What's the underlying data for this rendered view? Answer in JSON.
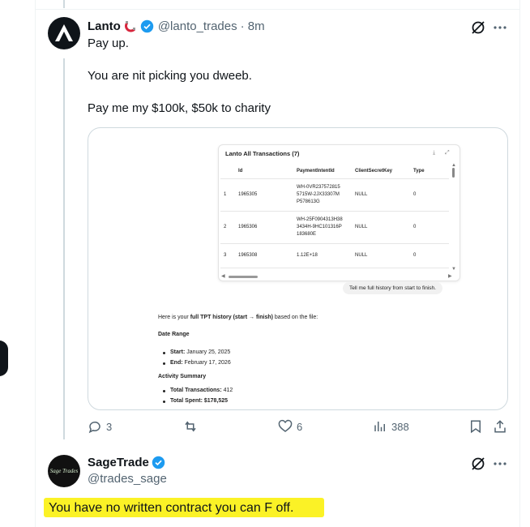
{
  "tweet": {
    "author_name": "Lanto",
    "handle": "@lanto_trades",
    "time": "· 8m",
    "lines": [
      "Pay up.",
      "You are nit picking you dweeb.",
      "Pay me my $100k, $50k to charity"
    ],
    "media": {
      "card_title": "Lanto All Transactions (7)",
      "columns": [
        "",
        "Id",
        "PaymentIntentId",
        "ClientSecretKey",
        "Type"
      ],
      "rows": [
        {
          "n": "1",
          "id": "1965305",
          "payment": "WH-0VR2375728155715W-2JX33307MP578613G",
          "p1": "WH-0VR237572815",
          "p2": "5715W-2JX33307M",
          "p3": "P578613G",
          "secret": "NULL",
          "type": "0"
        },
        {
          "n": "2",
          "id": "1965306",
          "payment": "WH-25F0904313H383434H-9HC101316P183680E",
          "p1": "WH-25F0904313H38",
          "p2": "3434H-9HC101316P",
          "p3": "183680E",
          "secret": "NULL",
          "type": "0"
        },
        {
          "n": "3",
          "id": "1965308",
          "payment": "1.12E+18",
          "p1": "1.12E+18",
          "p2": "",
          "p3": "",
          "secret": "NULL",
          "type": "0"
        }
      ],
      "prompt": "Tell me full history from start to finish.",
      "intro_pre": "Here is your ",
      "intro_bold": "full TPT history (start → finish)",
      "intro_post": " based on the file:",
      "section1": "Date Range",
      "start_label": "Start:",
      "start_value": " January 25, 2025",
      "end_label": "End:",
      "end_value": " February 17, 2026",
      "section2": "Activity Summary",
      "total_tx_label": "Total Transactions:",
      "total_tx_value": " 412",
      "total_spent_label": "Total Spent: $178,525"
    },
    "actions": {
      "replies": "3",
      "retweets": "",
      "likes": "6",
      "views": "388"
    }
  },
  "reply": {
    "author_name": "SageTrade",
    "handle": "@trades_sage",
    "avatar_text": "Sage Trades",
    "text": "You have no written contract you can F off."
  },
  "icons": [
    "grok-icon",
    "more-icon",
    "verified-badge-icon",
    "magnet-icon",
    "reply-icon",
    "retweet-icon",
    "like-icon",
    "views-icon",
    "bookmark-icon",
    "share-icon"
  ],
  "colors": {
    "verified": "#1d9bf0",
    "highlight": "#fbf226",
    "text": "#0f1419",
    "muted": "#536471"
  }
}
